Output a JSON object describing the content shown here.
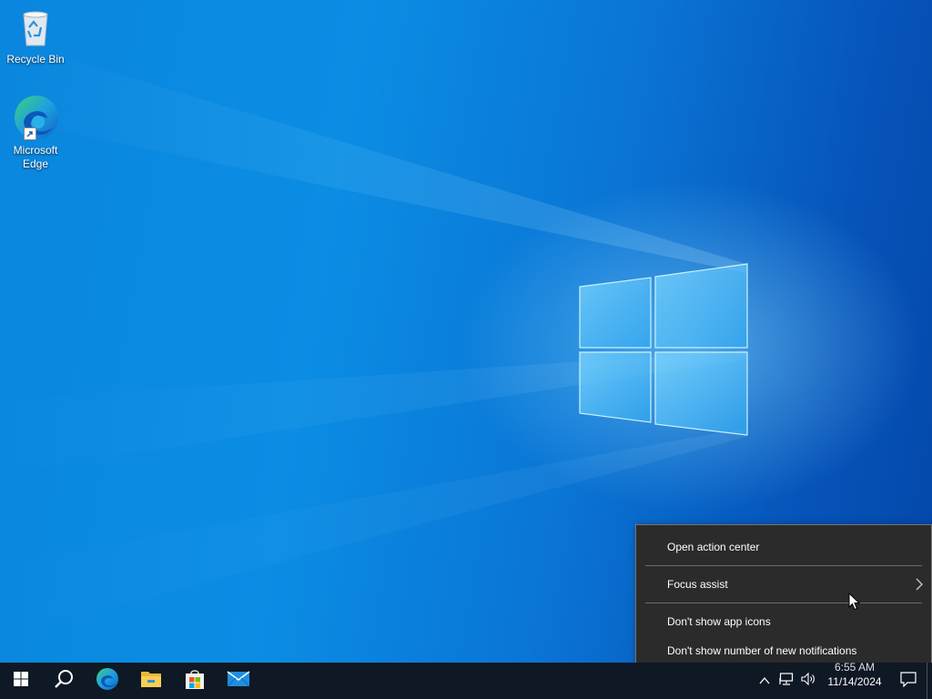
{
  "desktop": {
    "icons": [
      {
        "label": "Recycle Bin",
        "icon": "recycle-bin-icon"
      },
      {
        "label": "Microsoft Edge",
        "icon": "edge-icon"
      }
    ]
  },
  "context_menu": {
    "items": [
      {
        "label": "Open action center"
      },
      {
        "label": "Focus assist",
        "has_submenu": true
      },
      {
        "label": "Don't show app icons"
      },
      {
        "label": "Don't show number of new notifications"
      }
    ]
  },
  "taskbar": {
    "pinned": [
      {
        "icon": "start-windows-icon"
      },
      {
        "icon": "search-icon"
      },
      {
        "icon": "edge-icon"
      },
      {
        "icon": "file-explorer-icon"
      },
      {
        "icon": "microsoft-store-icon"
      },
      {
        "icon": "mail-icon"
      }
    ],
    "tray": {
      "icons": [
        "chevron-up-icon",
        "network-icon",
        "volume-icon"
      ],
      "time": "6:55 AM",
      "date": "11/14/2024",
      "notification_icon": "action-center-icon"
    }
  },
  "colors": {
    "desktop_blue": "#0a86dd",
    "taskbar_bg": "#0f1825",
    "menu_bg": "#2b2b2b",
    "menu_border": "#767676"
  }
}
